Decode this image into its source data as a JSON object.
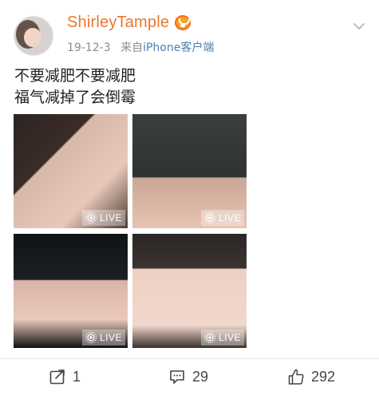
{
  "post": {
    "username": "ShirleyTample",
    "date": "19-12-3",
    "source_prefix": "来自",
    "source_name": "iPhone客户端",
    "text_lines": [
      "不要减肥不要减肥",
      "福气减掉了会倒霉"
    ]
  },
  "photos": [
    {
      "live_label": "LIVE"
    },
    {
      "live_label": "LIVE"
    },
    {
      "live_label": "LIVE"
    },
    {
      "live_label": "LIVE"
    }
  ],
  "actions": {
    "share_count": "1",
    "comment_count": "29",
    "like_count": "292"
  },
  "icons": {
    "badge": "vip-crown-icon",
    "menu": "chevron-down-icon",
    "share": "share-icon",
    "comment": "comment-icon",
    "like": "thumbs-up-icon",
    "live": "live-photo-icon"
  },
  "colors": {
    "username": "#e8772e",
    "source": "#4f7db2",
    "meta": "#8c8c8c"
  }
}
